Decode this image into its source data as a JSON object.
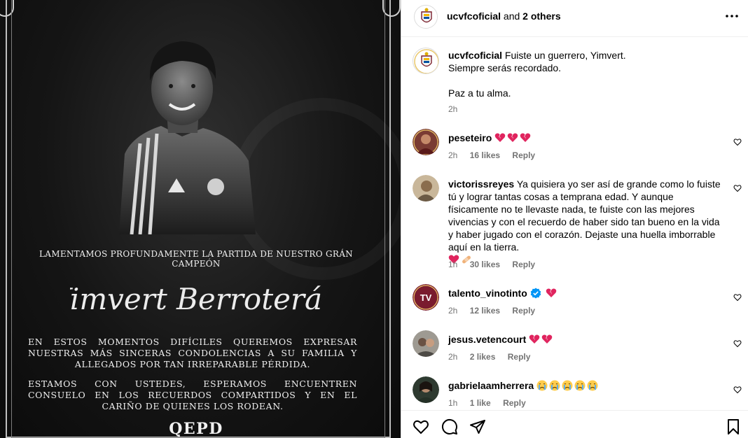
{
  "post": {
    "line1": "LAMENTAMOS PROFUNDAMENTE LA PARTIDA DE NUESTRO GRÁN CAMPEÓN",
    "name": "Yimvert Berroterán",
    "line2": "EN ESTOS MOMENTOS DIFÍCILES QUEREMOS EXPRESAR NUESTRAS MÁS SINCERAS CONDOLENCIAS A SU FAMILIA Y ALLEGADOS POR TAN IRREPARABLE PÉRDIDA.",
    "line3": "ESTAMOS CON USTEDES, ESPERAMOS ENCUENTREN CONSUELO EN LOS RECUERDOS COMPARTIDOS Y EN EL CARIÑO DE QUIENES LOS RODEAN.",
    "qepd": "QEPD"
  },
  "header": {
    "username": "ucvfcoficial",
    "and_text": " and ",
    "others": "2 others",
    "more_icon": "more-horizontal-icon"
  },
  "caption": {
    "username": "ucvfcoficial",
    "text1": "Fuiste un guerrero, Yimvert.",
    "text2": "Siempre serás recordado.",
    "text3": "Paz a tu alma.",
    "time": "2h"
  },
  "comments": [
    {
      "username": "peseteiro",
      "text": "",
      "time": "2h",
      "likes": "16 likes",
      "reply": "Reply",
      "emoji": "broken-heart x3"
    },
    {
      "username": "victorissreyes",
      "text": "Ya quisiera yo ser así de grande como lo fuiste tú y lograr tantas cosas a temprana edad. Y aunque físicamente no te llevaste nada, te fuiste con las mejores vivencias y con el recuerdo de haber sido tan bueno en la vida y haber jugado con el corazón. Dejaste una huella imborrable aquí en la tierra.",
      "time": "1h",
      "likes": "30 likes",
      "reply": "Reply",
      "emoji": "heart + bandage"
    },
    {
      "username": "talento_vinotinto",
      "text": "",
      "time": "2h",
      "likes": "12 likes",
      "reply": "Reply",
      "emoji": "verified + broken-heart"
    },
    {
      "username": "jesus.vetencourt",
      "text": "",
      "time": "2h",
      "likes": "2 likes",
      "reply": "Reply",
      "emoji": "broken-heart x2"
    },
    {
      "username": "gabrielaamherrera",
      "text": "",
      "time": "1h",
      "likes": "1 like",
      "reply": "Reply",
      "emoji": "crying-face x5"
    }
  ],
  "colors": {
    "heart_red": "#e0245e",
    "meta_gray": "#737373",
    "verified_blue": "#0095f6"
  },
  "footer": {
    "icons": [
      "heart-icon",
      "comment-icon",
      "share-icon",
      "bookmark-icon"
    ]
  }
}
